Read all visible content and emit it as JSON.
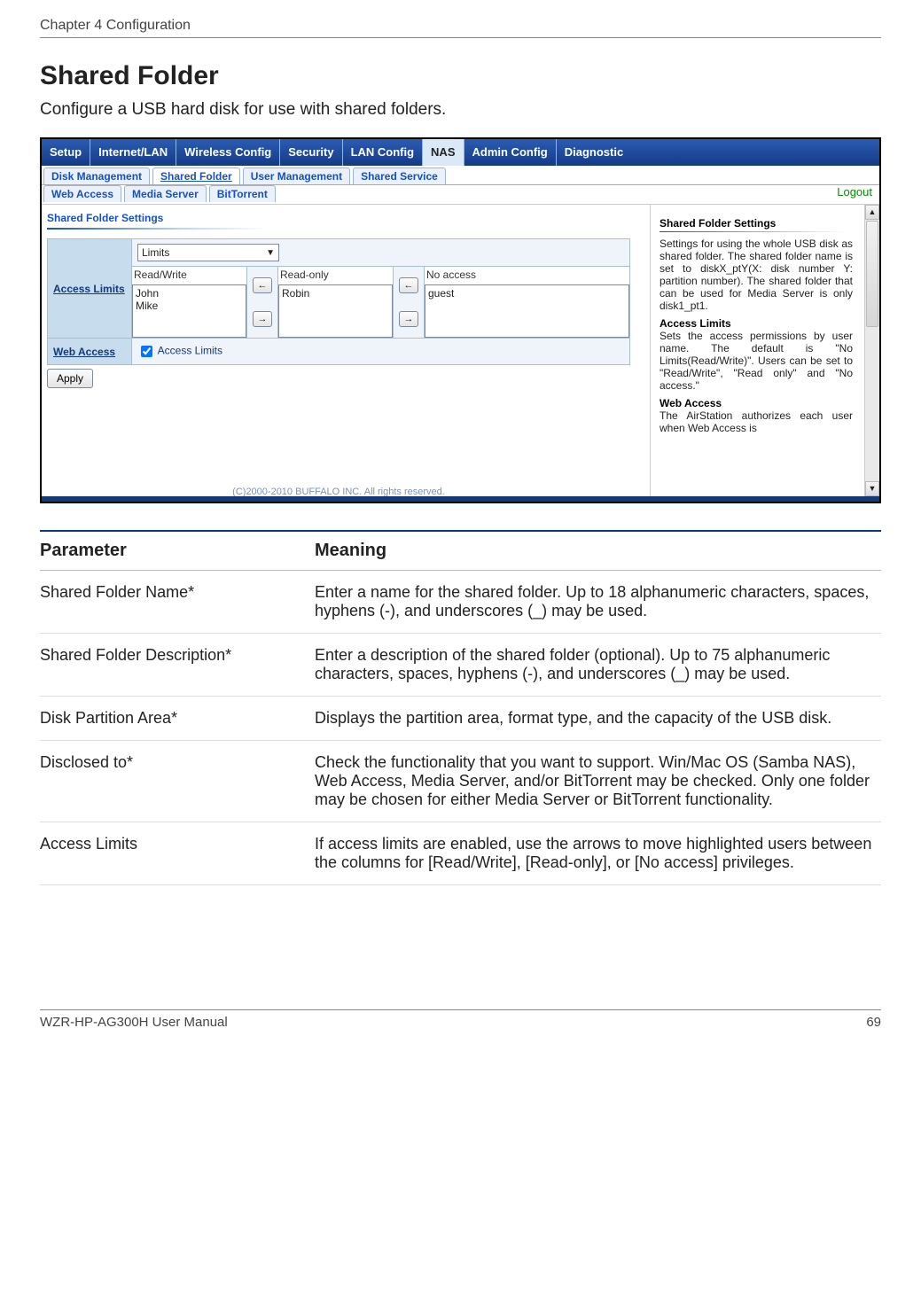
{
  "doc": {
    "chapter_header": "Chapter 4  Configuration",
    "section_title": "Shared Folder",
    "section_desc": "Configure a USB hard disk for use with shared folders.",
    "footer_left": "WZR-HP-AG300H User Manual",
    "footer_right": "69"
  },
  "ui": {
    "main_tabs": [
      "Setup",
      "Internet/LAN",
      "Wireless Config",
      "Security",
      "LAN Config",
      "NAS",
      "Admin Config",
      "Diagnostic"
    ],
    "active_main": "NAS",
    "sub_tabs_row1": [
      "Disk Management",
      "Shared Folder",
      "User Management",
      "Shared Service"
    ],
    "sub_tabs_row2": [
      "Web Access",
      "Media Server",
      "BitTorrent"
    ],
    "active_sub": "Shared Folder",
    "logout": "Logout",
    "panel_title": "Shared Folder Settings",
    "row_access_limits": "Access Limits",
    "row_web_access": "Web Access",
    "limits_select": "Limits",
    "col_rw": "Read/Write",
    "col_ro": "Read-only",
    "col_na": "No access",
    "list_rw": "John\nMike",
    "list_ro": "Robin",
    "list_na": "guest",
    "cb_label": "Access Limits",
    "apply": "Apply",
    "copyright": "(C)2000-2010 BUFFALO INC. All rights reserved.",
    "side": {
      "h1": "Shared Folder Settings",
      "p1": "Settings for using the whole USB disk as shared folder. The shared folder name is set to diskX_ptY(X: disk number Y: partition number). The shared folder that can be used for Media Server is only disk1_pt1.",
      "h2": "Access Limits",
      "p2": "Sets the access permissions by user name. The default is \"No Limits(Read/Write)\". Users can be set to \"Read/Write\", \"Read only\" and \"No access.\"",
      "h3": "Web Access",
      "p3": "The AirStation authorizes each user when Web Access is"
    }
  },
  "params": {
    "head_param": "Parameter",
    "head_meaning": "Meaning",
    "rows": [
      {
        "n": "Shared Folder Name*",
        "m": "Enter a name for the shared folder.  Up to 18 alphanumeric characters, spaces, hyphens (-), and underscores (_) may be used."
      },
      {
        "n": "Shared Folder Description*",
        "m": "Enter a description of the shared folder (optional).  Up to 75 alphanumeric characters, spaces, hyphens (-), and underscores (_) may be used."
      },
      {
        "n": "Disk Partition Area*",
        "m": "Displays the partition area, format type, and the capacity of the USB disk."
      },
      {
        "n": "Disclosed to*",
        "m": "Check the functionality that you want to support.  Win/Mac OS (Samba NAS), Web Access, Media Server, and/or BitTorrent may be checked.  Only one folder may be chosen for either Media Server or BitTorrent functionality."
      },
      {
        "n": "Access Limits",
        "m": "If access limits are enabled, use the arrows to move highlighted users between the columns for [Read/Write], [Read-only], or [No access] privileges."
      }
    ]
  }
}
